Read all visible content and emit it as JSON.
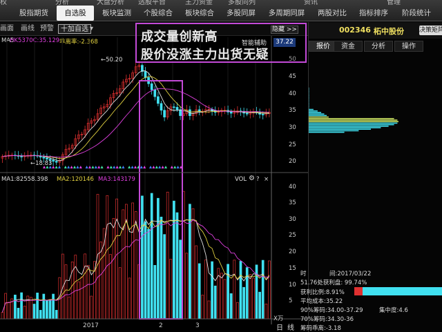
{
  "topnav": {
    "strip": [
      "权",
      "分析",
      "大盘分析",
      "选股平台",
      "主力资金",
      "多股同列",
      "资讯",
      "管理"
    ],
    "tabs": [
      "股指期货",
      "自选股",
      "板块监测",
      "个股综合",
      "板块综合",
      "多股同屏",
      "多周期同屏",
      "两股对比",
      "指标排序",
      "阶段统计"
    ],
    "active": "自选股"
  },
  "toolbar": {
    "items": [
      "画面",
      "画线",
      "预警"
    ],
    "add_btn": "十加自选",
    "add_arrow": "▾"
  },
  "indicator_line": {
    "ma_label": "MA5",
    "code": "HK5370C:35.129",
    "name": "乖离率:-2.368"
  },
  "callout": {
    "line1": "成交量创新高",
    "line2": "股价没涨主力出货无疑",
    "smart": "智能辅助",
    "hide": "隐藏 >>",
    "price_badge": "37.22"
  },
  "price_chart": {
    "high_label": "←50.20",
    "low_label": "←18.83",
    "y_ticks": [
      "50",
      "45",
      "40",
      "35",
      "30",
      "25",
      "20"
    ]
  },
  "volume_chart": {
    "ma1": "MA1:82558.398",
    "ma2": "MA2:120146",
    "ma3": "MA3:143179",
    "vol_label": "VOL",
    "y_ticks": [
      "40",
      "35",
      "30",
      "25",
      "20",
      "15",
      "10",
      "5"
    ],
    "unit": "X万"
  },
  "x_axis": {
    "labels": [
      "2017",
      "2",
      "3"
    ]
  },
  "bottom": {
    "day": "日",
    "line": "线"
  },
  "right_panel": {
    "code": "002346",
    "name": "柘中股份",
    "btn": "决策矩阵",
    "tabs": [
      "报价",
      "资金",
      "分析",
      "操作"
    ],
    "active_tab": "报价",
    "chip": {
      "time_label": "时",
      "time_value": "间:2017/03/22",
      "profit_line": "51.76处获利盘: 99.74%",
      "profit_ratio": "获利比例:8.91%",
      "avg_cost": "平均成本:35.22",
      "chip90": "90%筹码:34.00-37.29",
      "concentration": "集中度:4.6",
      "chip70": "70%筹码:34.30-36",
      "chip_skew": "筹码乖离:-3.18"
    }
  },
  "colors": {
    "up": "#e03030",
    "down": "#40e0f0",
    "ma_white": "#e0e0e0",
    "ma_yellow": "#e0d040",
    "ma_magenta": "#e040e0",
    "callout_border": "#c44ad8"
  }
}
